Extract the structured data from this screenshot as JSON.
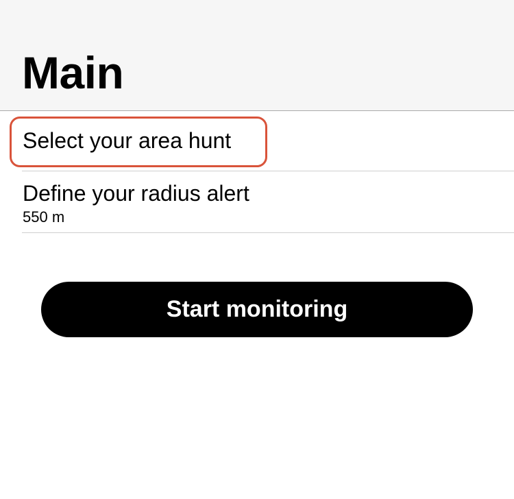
{
  "header": {
    "title": "Main"
  },
  "settings": {
    "items": [
      {
        "title": "Select your area hunt",
        "highlighted": true
      },
      {
        "title": "Define your radius alert",
        "subtitle": "550 m"
      }
    ]
  },
  "actions": {
    "start_label": "Start monitoring"
  },
  "colors": {
    "header_background": "#f6f6f6",
    "highlight": "#d9533a",
    "button_background": "#000000",
    "button_text": "#ffffff"
  }
}
